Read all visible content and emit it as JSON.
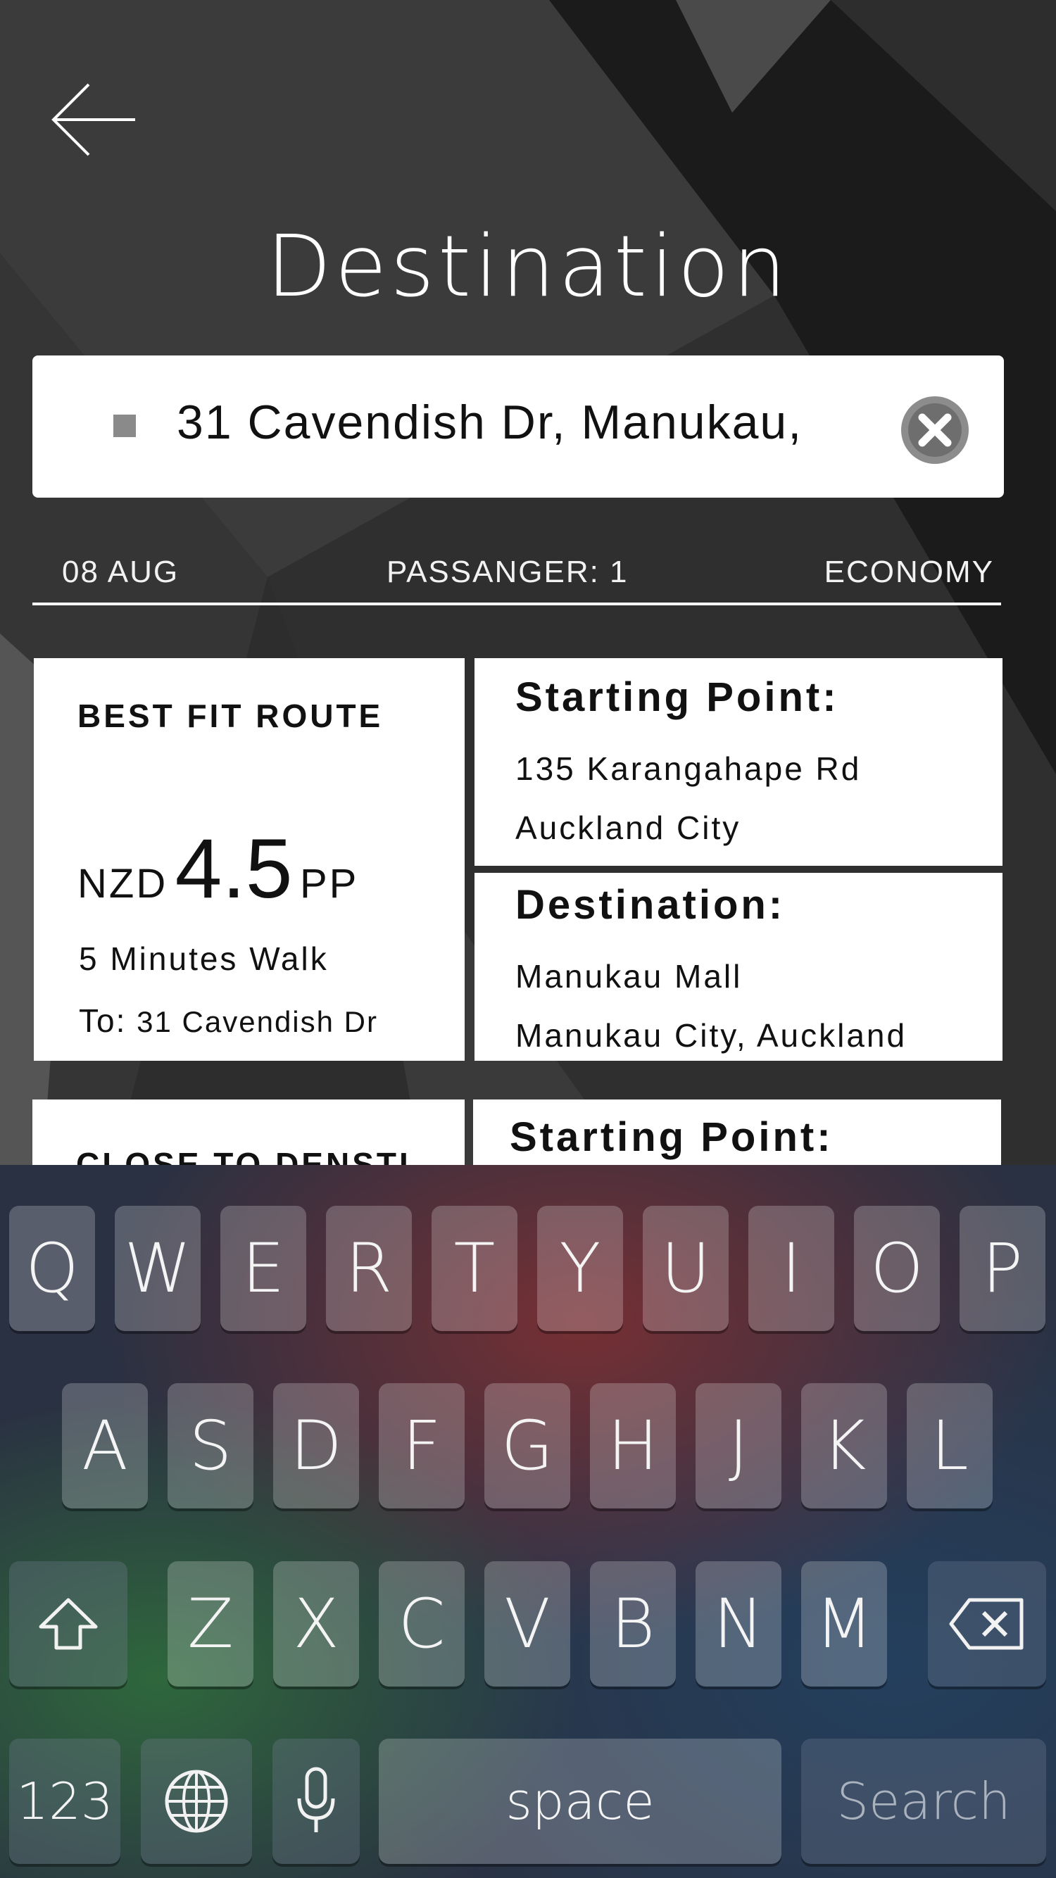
{
  "header": {
    "back_icon": "arrow-left-icon",
    "title": "Destination"
  },
  "search": {
    "value": "31 Cavendish Dr, Manukau,",
    "clear_icon": "clear-circle-x-icon",
    "location_icon": "square-marker-icon"
  },
  "trip": {
    "date": "08 AUG",
    "passengers": "PASSANGER: 1",
    "class": "ECONOMY"
  },
  "routes": [
    {
      "label": "BEST FIT ROUTE",
      "currency": "NZD",
      "price": "4.5",
      "price_unit": "PP",
      "walk": "5 Minutes Walk",
      "to_label": "To:",
      "to_value": "31 Cavendish Dr",
      "start_heading": "Starting Point:",
      "start_line1": "135 Karangahape Rd",
      "start_line2": "Auckland City",
      "dest_heading": "Destination:",
      "dest_line1": "Manukau Mall",
      "dest_line2": "Manukau City, Auckland"
    },
    {
      "label": "CLOSE TO DENSTI",
      "start_heading": "Starting Point:"
    }
  ],
  "keyboard": {
    "row1": [
      "Q",
      "W",
      "E",
      "R",
      "T",
      "Y",
      "U",
      "I",
      "O",
      "P"
    ],
    "row2": [
      "A",
      "S",
      "D",
      "F",
      "G",
      "H",
      "J",
      "K",
      "L"
    ],
    "row3": [
      "Z",
      "X",
      "C",
      "V",
      "B",
      "N",
      "M"
    ],
    "numbers_label": "123",
    "space_label": "space",
    "search_label": "Search",
    "shift_icon": "shift-arrow-icon",
    "delete_icon": "backspace-icon",
    "globe_icon": "globe-icon",
    "mic_icon": "microphone-icon"
  },
  "colors": {
    "background": "#2b2b2b",
    "card": "#ffffff",
    "text_dark": "#111111"
  }
}
